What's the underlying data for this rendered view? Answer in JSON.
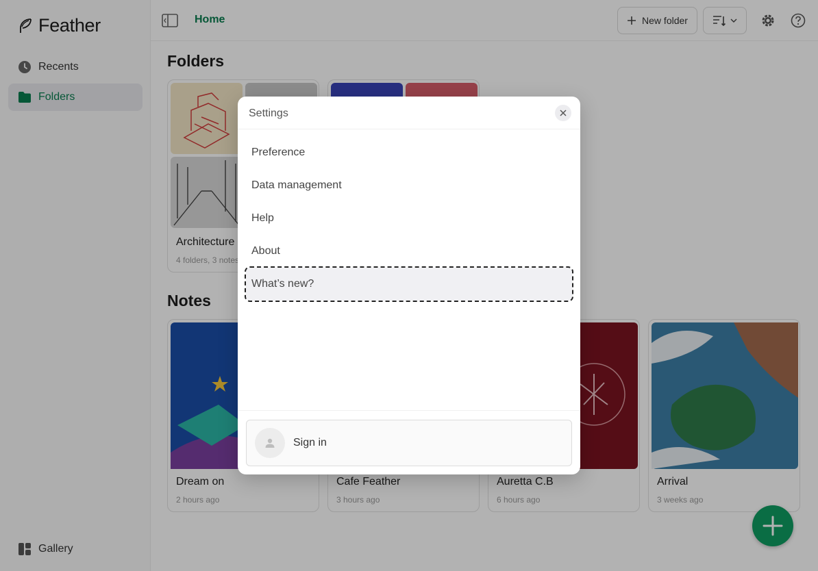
{
  "app": {
    "name": "Feather"
  },
  "sidebar": {
    "items": [
      {
        "label": "Recents",
        "icon": "clock-icon"
      },
      {
        "label": "Folders",
        "icon": "folder-icon",
        "active": true
      }
    ],
    "footer": {
      "label": "Gallery",
      "icon": "gallery-icon"
    }
  },
  "topbar": {
    "breadcrumb": "Home",
    "new_folder_label": "New folder"
  },
  "folders": {
    "title": "Folders",
    "items": [
      {
        "name": "Architecture",
        "meta": "4 folders, 3 notes"
      }
    ]
  },
  "notes": {
    "title": "Notes",
    "items": [
      {
        "name": "Dream on",
        "time": "2 hours ago"
      },
      {
        "name": "Cafe Feather",
        "time": "3 hours ago"
      },
      {
        "name": "Auretta C.B",
        "time": "6 hours ago"
      },
      {
        "name": "Arrival",
        "time": "3 weeks ago"
      }
    ]
  },
  "settings": {
    "title": "Settings",
    "items": [
      "Preference",
      "Data management",
      "Help",
      "About",
      "What’s new?"
    ],
    "highlighted_index": 4,
    "sign_in_label": "Sign in"
  },
  "colors": {
    "accent": "#0a7d4f",
    "fab": "#0f9d62"
  }
}
